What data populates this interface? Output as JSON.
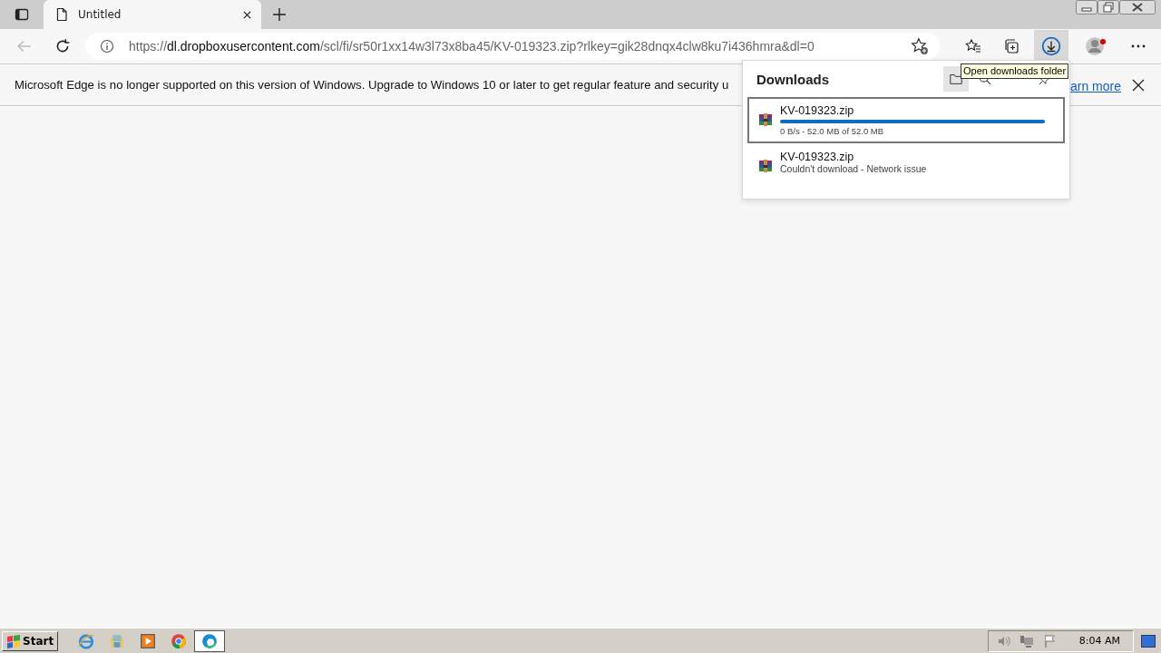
{
  "tab": {
    "title": "Untitled"
  },
  "address": {
    "scheme": "https://",
    "host": "dl.dropboxusercontent.com",
    "path": "/scl/fi/sr50r1xx14w3l73x8ba45/KV-019323.zip?rlkey=gik28dnqx4clw8ku7i436hmra&dl=0"
  },
  "banner": {
    "message": "Microsoft Edge is no longer supported on this version of Windows. Upgrade to Windows 10 or later to get regular feature and security u",
    "link": "arn more"
  },
  "downloads": {
    "title": "Downloads",
    "tooltip": "Open downloads folder",
    "items": [
      {
        "kind": "progress",
        "name": "KV-019323.zip",
        "status": "0 B/s - 52.0 MB of 52.0 MB",
        "level": 1,
        "selected": true
      },
      {
        "kind": "failed",
        "name": "KV-019323.zip",
        "status": "Couldn't download - Network issue",
        "selected": false
      }
    ]
  },
  "taskbar": {
    "start": "Start",
    "clock": "8:04 AM"
  }
}
